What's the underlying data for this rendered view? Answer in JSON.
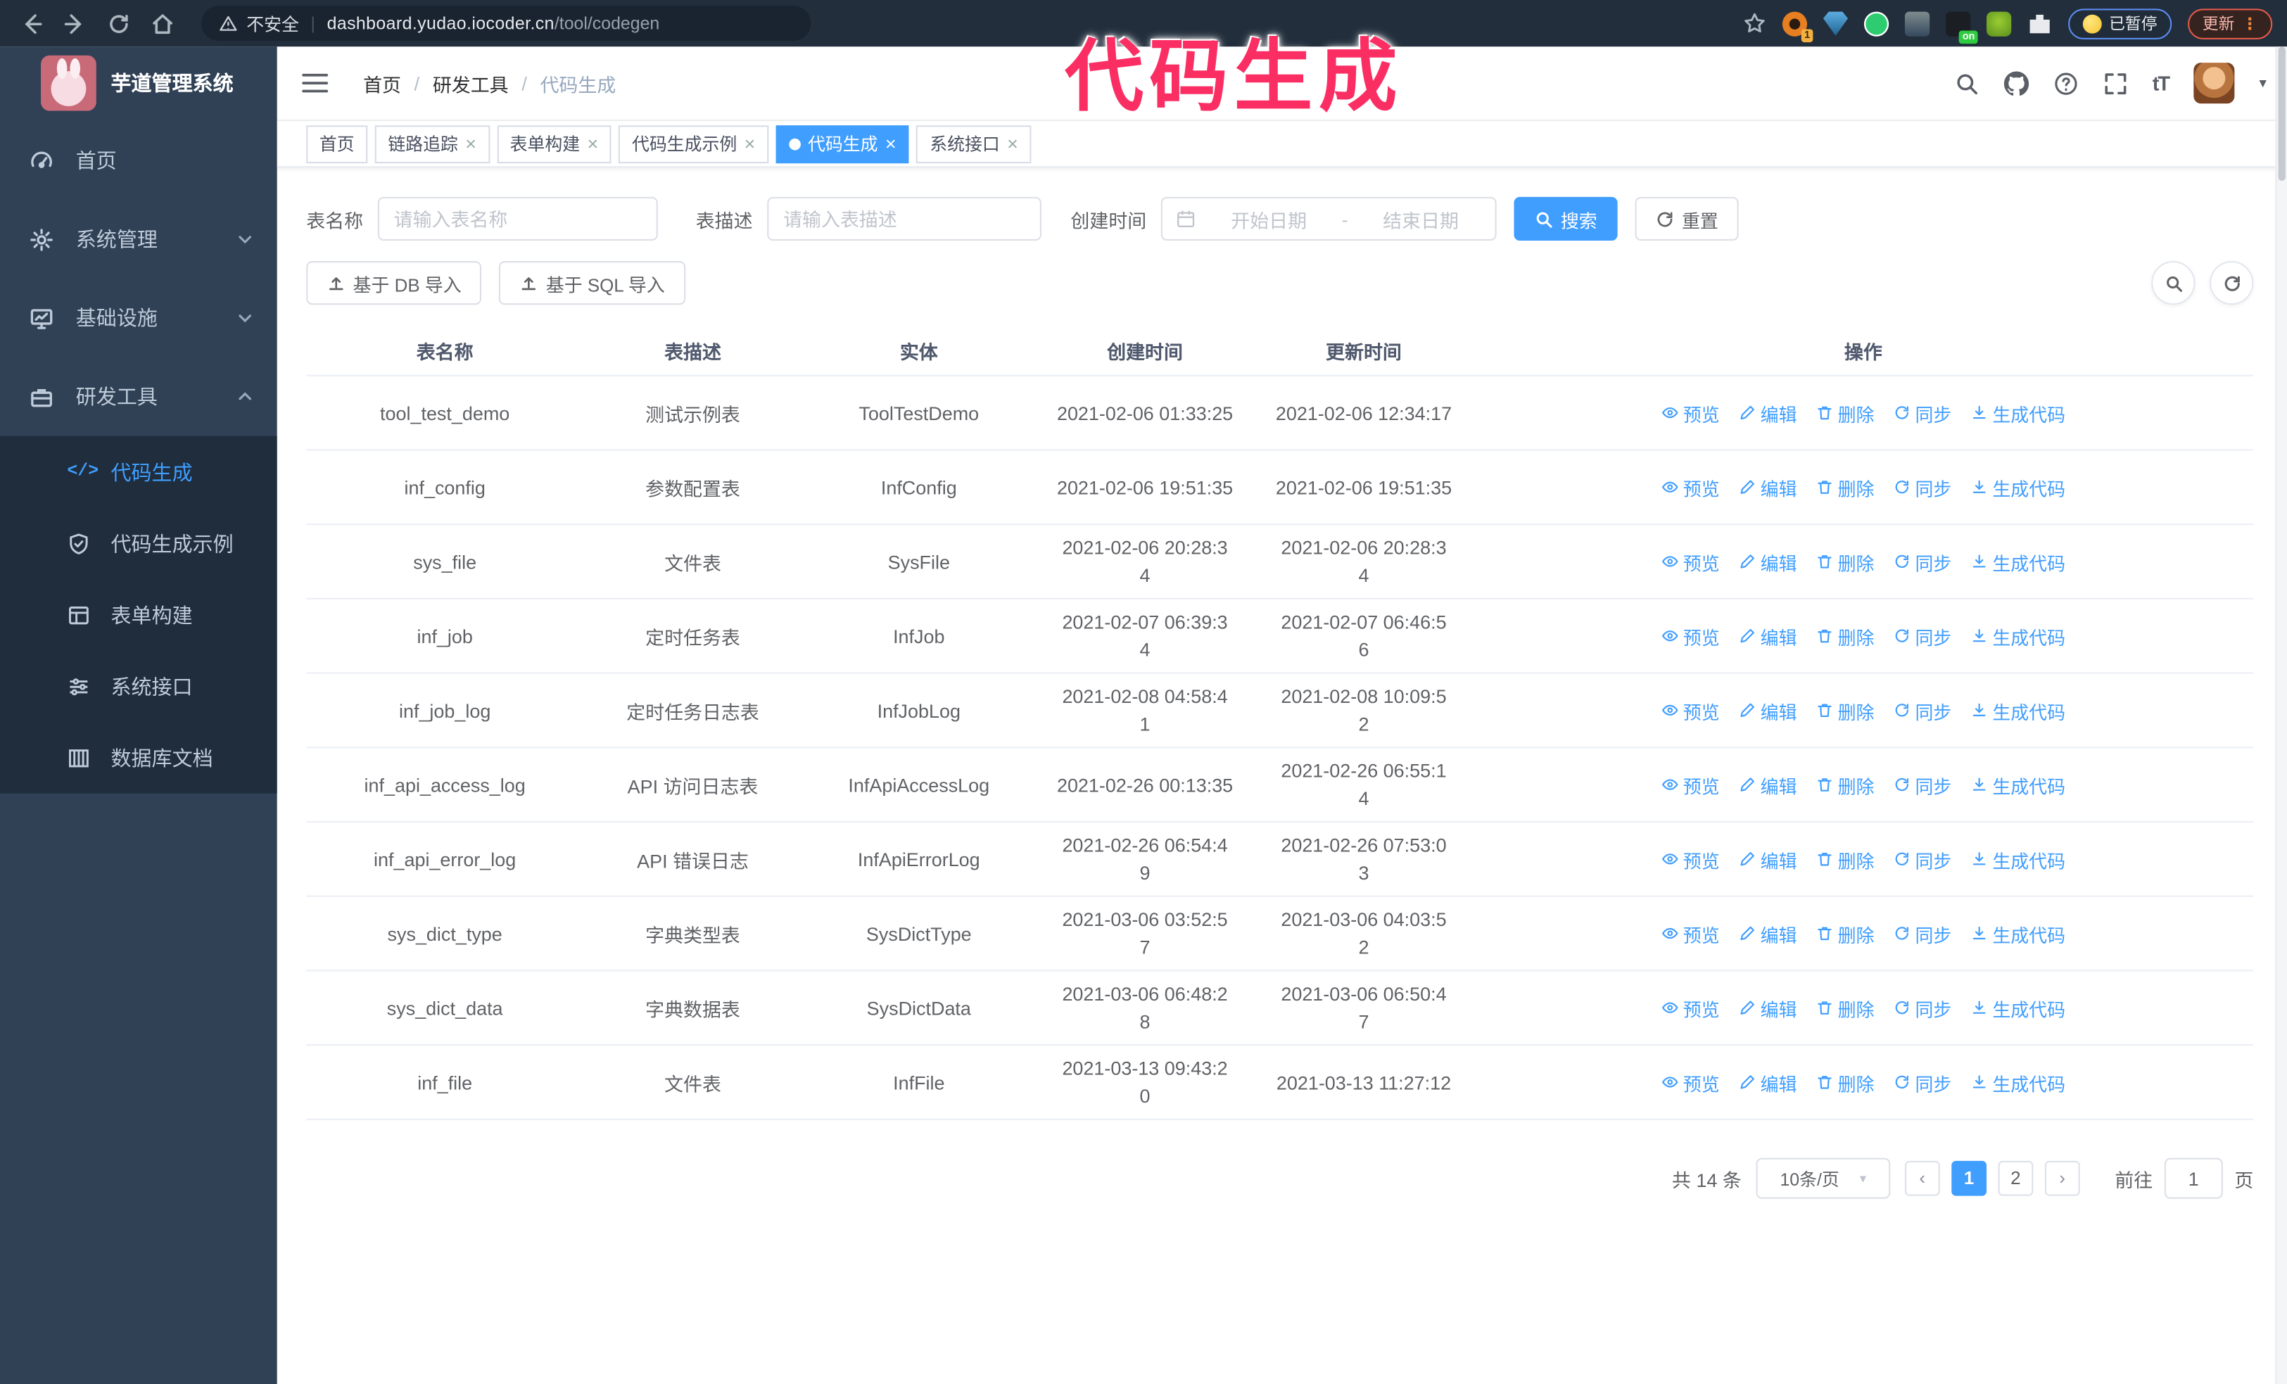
{
  "browser": {
    "security_label": "不安全",
    "url_host": "dashboard.yudao.iocoder.cn",
    "url_path": "/tool/codegen",
    "extension_badge": "1",
    "extension_on_badge": "on",
    "paused_badge": "已暂停",
    "update_button": "更新",
    "update_dots": "⋮"
  },
  "annotation": {
    "text": "代码生成",
    "color": "#fb2e64"
  },
  "sidebar": {
    "title": "芋道管理系统",
    "items": [
      {
        "label": "首页"
      },
      {
        "label": "系统管理"
      },
      {
        "label": "基础设施"
      },
      {
        "label": "研发工具"
      }
    ],
    "subitems": [
      {
        "label": "代码生成"
      },
      {
        "label": "代码生成示例"
      },
      {
        "label": "表单构建"
      },
      {
        "label": "系统接口"
      },
      {
        "label": "数据库文档"
      }
    ]
  },
  "header": {
    "breadcrumb": [
      "首页",
      "研发工具",
      "代码生成"
    ],
    "breadcrumb_separator": "/"
  },
  "tabs": [
    {
      "label": "首页",
      "closable": false,
      "active": false
    },
    {
      "label": "链路追踪",
      "closable": true,
      "active": false
    },
    {
      "label": "表单构建",
      "closable": true,
      "active": false
    },
    {
      "label": "代码生成示例",
      "closable": true,
      "active": false
    },
    {
      "label": "代码生成",
      "closable": true,
      "active": true
    },
    {
      "label": "系统接口",
      "closable": true,
      "active": false
    }
  ],
  "filters": {
    "table_name_label": "表名称",
    "table_name_placeholder": "请输入表名称",
    "table_desc_label": "表描述",
    "table_desc_placeholder": "请输入表描述",
    "create_time_label": "创建时间",
    "date_start_placeholder": "开始日期",
    "date_separator": "-",
    "date_end_placeholder": "结束日期",
    "search_label": "搜索",
    "reset_label": "重置"
  },
  "toolbar": {
    "import_db_label": "基于 DB 导入",
    "import_sql_label": "基于 SQL 导入"
  },
  "table": {
    "columns": [
      "表名称",
      "表描述",
      "实体",
      "创建时间",
      "更新时间",
      "操作"
    ],
    "row_actions": [
      {
        "label": "预览"
      },
      {
        "label": "编辑"
      },
      {
        "label": "删除"
      },
      {
        "label": "同步"
      },
      {
        "label": "生成代码"
      }
    ],
    "rows": [
      {
        "name": "tool_test_demo",
        "desc": "测试示例表",
        "entity": "ToolTestDemo",
        "created": "2021-02-06 01:33:25",
        "updated": "2021-02-06 12:34:17"
      },
      {
        "name": "inf_config",
        "desc": "参数配置表",
        "entity": "InfConfig",
        "created": "2021-02-06 19:51:35",
        "updated": "2021-02-06 19:51:35"
      },
      {
        "name": "sys_file",
        "desc": "文件表",
        "entity": "SysFile",
        "created": "2021-02-06 20:28:3\n4",
        "updated": "2021-02-06 20:28:3\n4"
      },
      {
        "name": "inf_job",
        "desc": "定时任务表",
        "entity": "InfJob",
        "created": "2021-02-07 06:39:3\n4",
        "updated": "2021-02-07 06:46:5\n6"
      },
      {
        "name": "inf_job_log",
        "desc": "定时任务日志表",
        "entity": "InfJobLog",
        "created": "2021-02-08 04:58:4\n1",
        "updated": "2021-02-08 10:09:5\n2"
      },
      {
        "name": "inf_api_access_log",
        "desc": "API 访问日志表",
        "entity": "InfApiAccessLog",
        "created": "2021-02-26 00:13:35",
        "updated": "2021-02-26 06:55:1\n4"
      },
      {
        "name": "inf_api_error_log",
        "desc": "API 错误日志",
        "entity": "InfApiErrorLog",
        "created": "2021-02-26 06:54:4\n9",
        "updated": "2021-02-26 07:53:0\n3"
      },
      {
        "name": "sys_dict_type",
        "desc": "字典类型表",
        "entity": "SysDictType",
        "created": "2021-03-06 03:52:5\n7",
        "updated": "2021-03-06 04:03:5\n2"
      },
      {
        "name": "sys_dict_data",
        "desc": "字典数据表",
        "entity": "SysDictData",
        "created": "2021-03-06 06:48:2\n8",
        "updated": "2021-03-06 06:50:4\n7"
      },
      {
        "name": "inf_file",
        "desc": "文件表",
        "entity": "InfFile",
        "created": "2021-03-13 09:43:2\n0",
        "updated": "2021-03-13 11:27:12"
      }
    ]
  },
  "pagination": {
    "total": "共 14 条",
    "page_size": "10条/页",
    "pages": [
      "1",
      "2"
    ],
    "active_page": "1",
    "goto_label": "前往",
    "goto_value": "1",
    "page_suffix": "页"
  },
  "ui": {
    "close_glyph": "×",
    "prev_glyph": "‹",
    "next_glyph": "›",
    "caret_glyph": "▾"
  }
}
